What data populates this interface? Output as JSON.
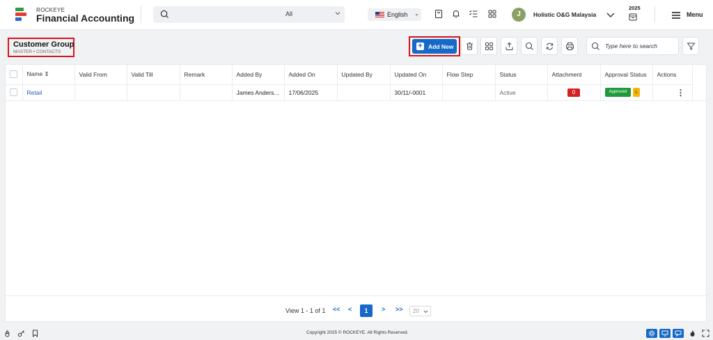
{
  "header": {
    "brand_small": "ROCKEYE",
    "brand_big": "Financial Accounting",
    "search_scope": "All",
    "language": "English",
    "avatar_letter": "J",
    "company": "Holistic O&G Malaysia",
    "year": "2025",
    "menu_label": "Menu"
  },
  "page": {
    "title": "Customer Group",
    "breadcrumb": "MASTER  •  CONTACTS",
    "add_new_label": "Add New",
    "search_placeholder": "Type here to search"
  },
  "table": {
    "columns": [
      "Name ⇕",
      "Valid From",
      "Valid Till",
      "Remark",
      "Added By",
      "Added On",
      "Updated By",
      "Updated On",
      "Flow Step",
      "Status",
      "Attachment",
      "Approval Status",
      "Actions"
    ],
    "rows": [
      {
        "name": "Retail",
        "valid_from": "",
        "valid_till": "",
        "remark": "",
        "added_by": "James Anders...",
        "added_on": "17/06/2025",
        "updated_by": "",
        "updated_on": "30/11/-0001",
        "flow_step": "",
        "status": "Active",
        "attachment": "0",
        "approval": "Approved",
        "approval_level": "L"
      }
    ]
  },
  "pagination": {
    "view_text": "View 1 - 1 of 1",
    "first": "<<",
    "prev": "<",
    "current": "1",
    "next": ">",
    "last": ">>",
    "page_size": "20"
  },
  "footer": {
    "copyright": "Copyright 2025 © ROCKEYE. All Rights Reserved."
  },
  "colors": {
    "primary": "#1669c7",
    "highlight": "#d0161d",
    "approved": "#1f9a3a",
    "attachment": "#d32222",
    "level": "#f2b705"
  }
}
